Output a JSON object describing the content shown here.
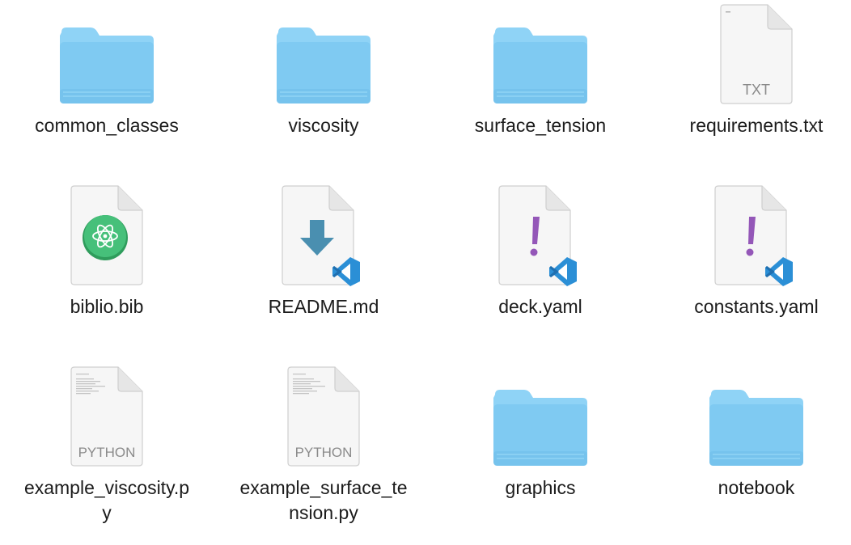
{
  "items": [
    {
      "label": "common_classes",
      "kind": "folder",
      "icon": "folder-icon"
    },
    {
      "label": "viscosity",
      "kind": "folder",
      "icon": "folder-icon"
    },
    {
      "label": "surface_tension",
      "kind": "folder",
      "icon": "folder-icon"
    },
    {
      "label": "requirements.txt",
      "kind": "document",
      "icon": "txt-document-icon",
      "badge": "TXT"
    },
    {
      "label": "biblio.bib",
      "kind": "document",
      "icon": "atom-document-icon"
    },
    {
      "label": "README.md",
      "kind": "document",
      "icon": "markdown-vscode-document-icon"
    },
    {
      "label": "deck.yaml",
      "kind": "document",
      "icon": "yaml-vscode-document-icon"
    },
    {
      "label": "constants.yaml",
      "kind": "document",
      "icon": "yaml-vscode-document-icon"
    },
    {
      "label_lines": [
        "example_viscosity.p",
        "y"
      ],
      "kind": "document",
      "icon": "python-document-icon",
      "badge": "PYTHON"
    },
    {
      "label_lines": [
        "example_surface_te",
        "nsion.py"
      ],
      "kind": "document",
      "icon": "python-document-icon",
      "badge": "PYTHON"
    },
    {
      "label": "graphics",
      "kind": "folder",
      "icon": "folder-icon"
    },
    {
      "label": "notebook",
      "kind": "folder",
      "icon": "folder-icon"
    }
  ],
  "colors": {
    "folder_light": "#9fdcf9",
    "folder_main": "#7cc9f2",
    "folder_dark": "#6ab8e6",
    "doc_page": "#f7f7f7",
    "doc_border": "#c9c9c9",
    "badge_text": "#8a8a8a",
    "markdown_arrow": "#4a8fb0",
    "vscode_blue": "#2b8fd6",
    "yaml_exclaim": "#9457b8",
    "atom_green": "#3fb56e"
  }
}
